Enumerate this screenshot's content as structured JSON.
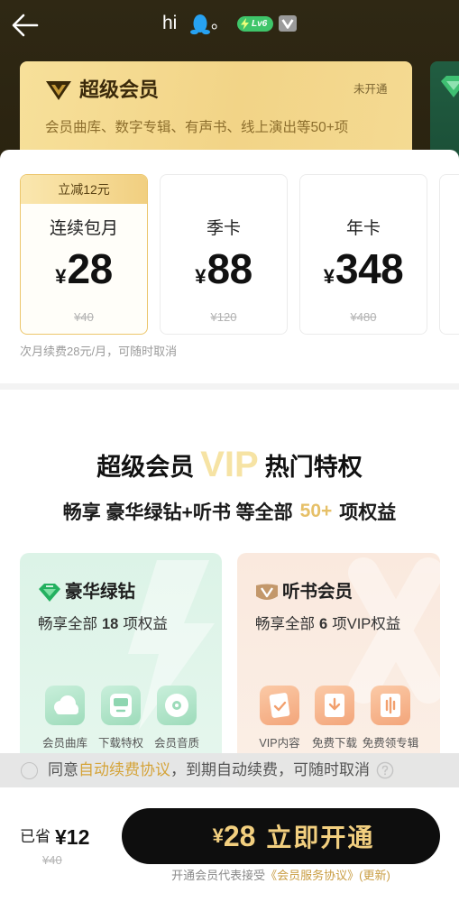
{
  "header": {
    "greeting": "hi",
    "punctuation": "。",
    "level_badge": "Lv6",
    "icons": [
      "back-arrow-icon",
      "qq-penguin-icon",
      "lightning-icon",
      "vip-badge-icon"
    ]
  },
  "membership_card": {
    "icon": "super-vip-logo-icon",
    "title": "超级会员",
    "status": "未开通",
    "description": "会员曲库、数字专辑、有声书、线上演出等50+项"
  },
  "currency": "¥",
  "plans": [
    {
      "tag": "立减12元",
      "name": "连续包月",
      "price": "28",
      "original_price": "¥40",
      "selected": true
    },
    {
      "name": "季卡",
      "price": "88",
      "original_price": "¥120",
      "selected": false
    },
    {
      "name": "年卡",
      "price": "348",
      "original_price": "¥480",
      "selected": false
    }
  ],
  "renewal_note": "次月续费28元/月，可随时取消",
  "privileges": {
    "heading": {
      "prefix": "超级会员",
      "highlight": "VIP",
      "suffix": "热门特权"
    },
    "subheading": {
      "prefix": "畅享 豪华绿钻+听书 等全部",
      "highlight": "50+",
      "suffix": "项权益"
    },
    "cards": [
      {
        "icon": "green-diamond-icon",
        "title": "豪华绿钻",
        "desc_prefix": "畅享全部",
        "count": "18",
        "desc_suffix": "项权益",
        "items": [
          {
            "label": "会员曲库",
            "icon": "cloud-music-icon"
          },
          {
            "label": "下载特权",
            "icon": "download-box-icon"
          },
          {
            "label": "会员音质",
            "icon": "disc-icon"
          }
        ]
      },
      {
        "icon": "audiobook-vip-icon",
        "title": "听书会员",
        "desc_prefix": "畅享全部",
        "count": "6",
        "desc_suffix": "项VIP权益",
        "items": [
          {
            "label": "VIP内容",
            "icon": "vip-content-icon"
          },
          {
            "label": "免费下载",
            "icon": "free-download-icon"
          },
          {
            "label": "免费领专辑",
            "icon": "free-album-icon"
          }
        ]
      }
    ]
  },
  "agreement": {
    "prefix": "同意",
    "link": "自动续费协议",
    "suffix": "，到期自动续费，可随时取消",
    "checked": false
  },
  "checkout": {
    "saved_label": "已省",
    "saved_amount": "¥12",
    "original_total": "¥40",
    "button": {
      "currency": "¥",
      "price": "28",
      "label": "立即开通"
    },
    "terms_prefix": "开通会员代表接受",
    "terms_link": "《会员服务协议》(更新)"
  },
  "colors": {
    "header_bg": "#2b2412",
    "gold_card": "#f3d78c",
    "accent_gold": "#d5a43a",
    "button_bg": "#0e0e0e",
    "button_text": "#f2cf7f",
    "level_green": "#3fc56a"
  }
}
